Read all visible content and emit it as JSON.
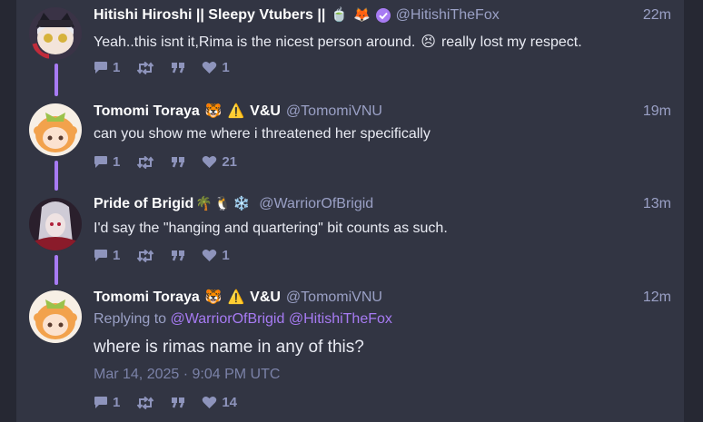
{
  "posts": [
    {
      "name": "Hitishi Hiroshi || Sleepy Vtubers ||",
      "name_emojis": [
        "🍵",
        "🦊"
      ],
      "verified": true,
      "handle": "@HitishiTheFox",
      "time": "22m",
      "text_before": "Yeah..this isnt it,Rima is the nicest person around.",
      "text_emoji": "😣",
      "text_after": "really lost my respect.",
      "replies": "1",
      "likes": "1"
    },
    {
      "name": "Tomomi Toraya",
      "name_emojis": [
        "🐯",
        "⚠️"
      ],
      "name_suffix": "V&U",
      "handle": "@TomomiVNU",
      "time": "19m",
      "text": "can you show me where i threatened her specifically",
      "replies": "1",
      "likes": "21"
    },
    {
      "name": "Pride of Brigid",
      "name_emojis": [
        "🌴",
        "🐧",
        "❄️"
      ],
      "handle": "@WarriorOfBrigid",
      "time": "13m",
      "text": "I'd say the \"hanging and quartering\" bit counts as such.",
      "replies": "1",
      "likes": "1"
    },
    {
      "name": "Tomomi Toraya",
      "name_emojis": [
        "🐯",
        "⚠️"
      ],
      "name_suffix": "V&U",
      "handle": "@TomomiVNU",
      "time": "12m",
      "replying_label": "Replying to",
      "mentions": [
        "@WarriorOfBrigid",
        "@HitishiTheFox"
      ],
      "text": "where is rimas name in any of this?",
      "date": "Mar 14, 2025 · 9:04 PM UTC",
      "replies": "1",
      "likes": "14"
    }
  ],
  "colors": {
    "accent": "#a77bf3",
    "panel": "#323543",
    "background": "#262833"
  },
  "icons": [
    "comment-icon",
    "retweet-icon",
    "quote-icon",
    "heart-icon"
  ]
}
